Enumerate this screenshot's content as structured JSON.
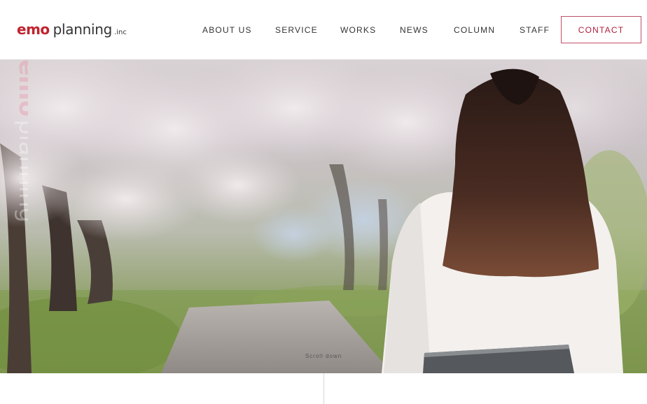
{
  "logo": {
    "emo": "emo",
    "planning": "planning",
    "inc": ".inc"
  },
  "nav": {
    "items": [
      {
        "label": "ABOUT US"
      },
      {
        "label": "SERVICE"
      },
      {
        "label": "WORKS"
      },
      {
        "label": "NEWS"
      },
      {
        "label": "COLUMN"
      },
      {
        "label": "STAFF"
      }
    ],
    "contact": "CONTACT"
  },
  "hero": {
    "scroll_label": "Scroll down",
    "watermark": "emo planning"
  },
  "colors": {
    "brand_red": "#c0232d",
    "contact_border": "#c0506a",
    "divider": "#d8d8d8"
  }
}
